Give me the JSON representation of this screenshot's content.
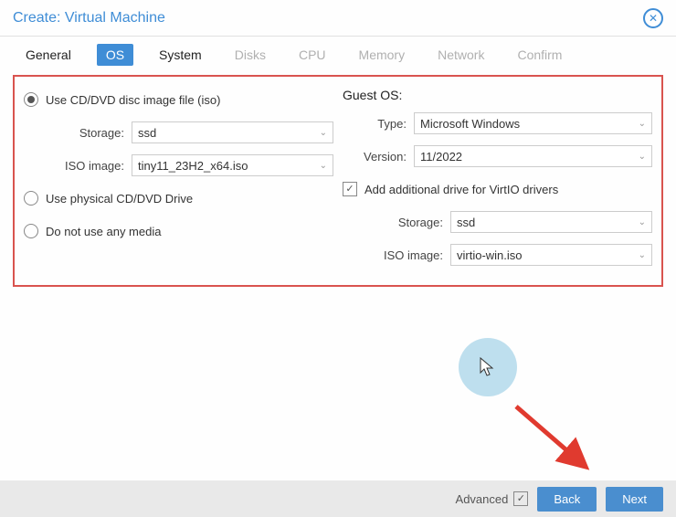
{
  "window": {
    "title": "Create: Virtual Machine"
  },
  "tabs": [
    {
      "label": "General",
      "state": "strong"
    },
    {
      "label": "OS",
      "state": "active"
    },
    {
      "label": "System",
      "state": "strong"
    },
    {
      "label": "Disks",
      "state": "disabled"
    },
    {
      "label": "CPU",
      "state": "disabled"
    },
    {
      "label": "Memory",
      "state": "disabled"
    },
    {
      "label": "Network",
      "state": "disabled"
    },
    {
      "label": "Confirm",
      "state": "disabled"
    }
  ],
  "media": {
    "radio_iso": "Use CD/DVD disc image file (iso)",
    "radio_physical": "Use physical CD/DVD Drive",
    "radio_none": "Do not use any media",
    "selected": "iso",
    "storage_label": "Storage:",
    "storage_value": "ssd",
    "iso_label": "ISO image:",
    "iso_value": "tiny11_23H2_x64.iso"
  },
  "guest": {
    "heading": "Guest OS:",
    "type_label": "Type:",
    "type_value": "Microsoft Windows",
    "version_label": "Version:",
    "version_value": "11/2022",
    "virtio_checkbox": "Add additional drive for VirtIO drivers",
    "virtio_checked": true,
    "storage_label": "Storage:",
    "storage_value": "ssd",
    "iso_label": "ISO image:",
    "iso_value": "virtio-win.iso"
  },
  "footer": {
    "advanced_label": "Advanced",
    "advanced_checked": true,
    "back_label": "Back",
    "next_label": "Next"
  }
}
